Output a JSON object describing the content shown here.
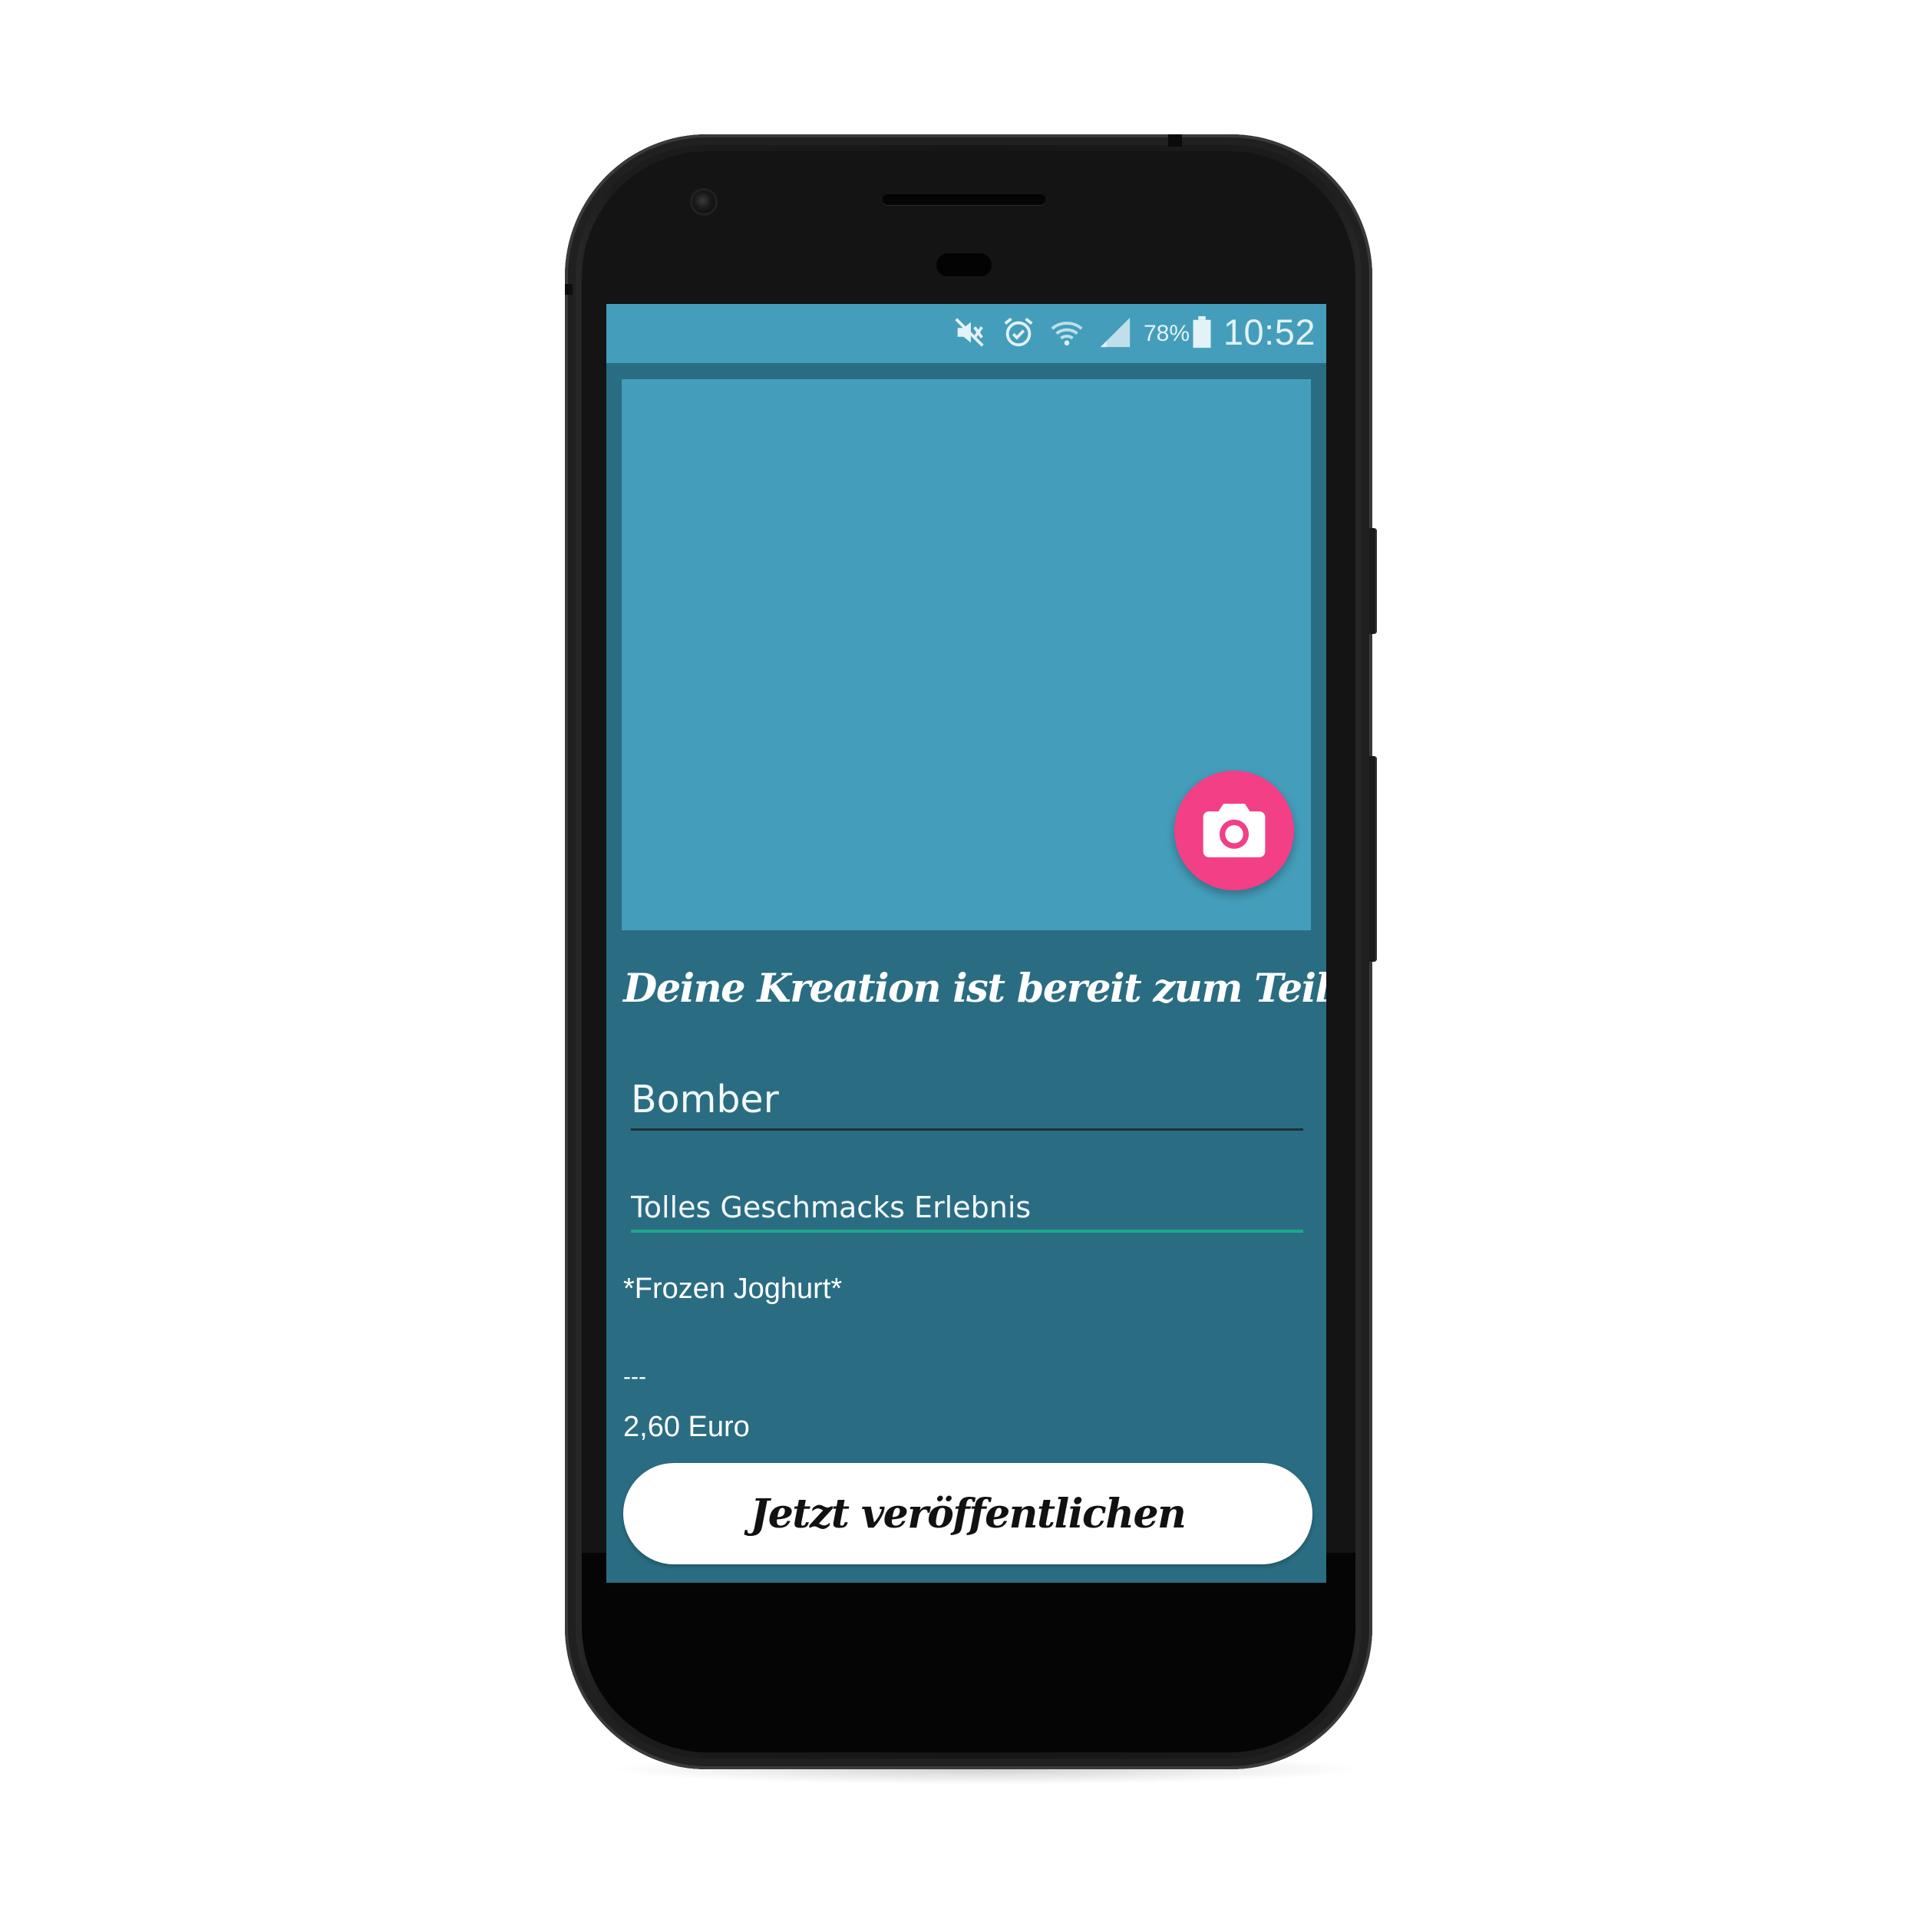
{
  "status_bar": {
    "battery_percent": "78%",
    "time": "10:52",
    "icons": [
      "mute-icon",
      "alarm-icon",
      "wifi-icon",
      "signal-icon",
      "battery-icon"
    ]
  },
  "image_picker": {
    "camera_button_icon": "camera-icon"
  },
  "headline": "Deine Kreation ist bereit zum Teilen!",
  "form": {
    "name_value": "Bomber",
    "description_value": "Tolles Geschmacks Erlebnis"
  },
  "details": {
    "category": "*Frozen Joghurt*",
    "separator": "---",
    "price": "2,60 Euro"
  },
  "publish_button_label": "Jetzt veröffentlichen",
  "colors": {
    "screen_background": "#2a6d82",
    "status_bar": "#449ebb",
    "image_area": "#449ebb",
    "camera_fab": "#f23f85",
    "field_focus_underline": "#1ea88a",
    "button_background": "#ffffff"
  }
}
